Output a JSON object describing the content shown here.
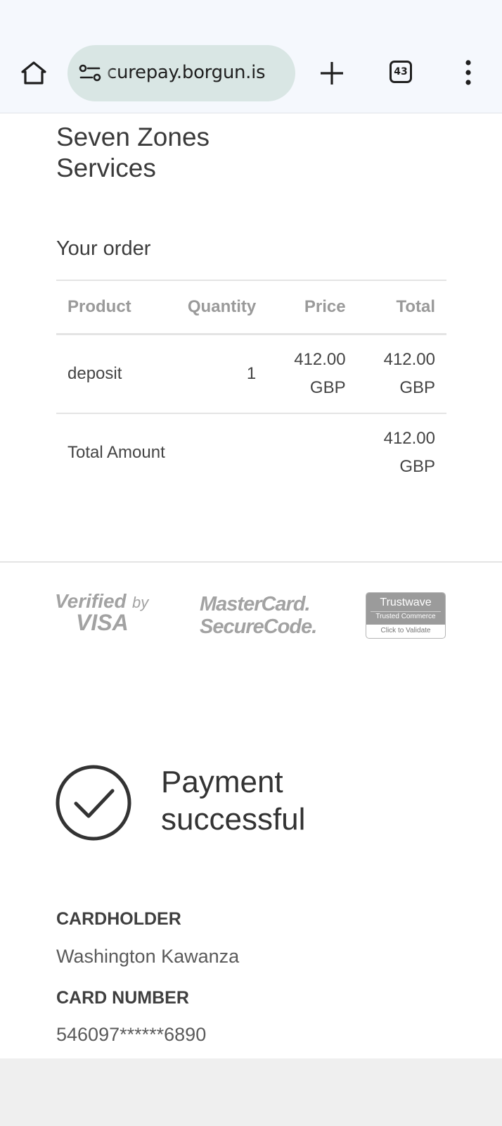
{
  "browser": {
    "url": "curepay.borgun.is",
    "tab_count": "43"
  },
  "merchant": {
    "name": "Seven Zones Services"
  },
  "order": {
    "title": "Your order",
    "columns": {
      "product": "Product",
      "quantity": "Quantity",
      "price": "Price",
      "total": "Total"
    },
    "items": [
      {
        "product": "deposit",
        "quantity": "1",
        "price_value": "412.00",
        "price_currency": "GBP",
        "total_value": "412.00",
        "total_currency": "GBP"
      }
    ],
    "total_label": "Total Amount",
    "total_value": "412.00",
    "total_currency": "GBP"
  },
  "badges": {
    "visa_line1": "Verified",
    "visa_by": "by",
    "visa_line2": "VISA",
    "mastercard_line1": "MasterCard.",
    "mastercard_line2": "SecureCode.",
    "trustwave_name": "Trustwave",
    "trustwave_sub": "Trusted Commerce",
    "trustwave_cta": "Click to Validate"
  },
  "payment": {
    "status": "Payment successful",
    "cardholder_label": "CARDHOLDER",
    "cardholder_value": "Washington Kawanza",
    "card_number_label": "CARD NUMBER",
    "card_number_value": "546097******6890"
  }
}
